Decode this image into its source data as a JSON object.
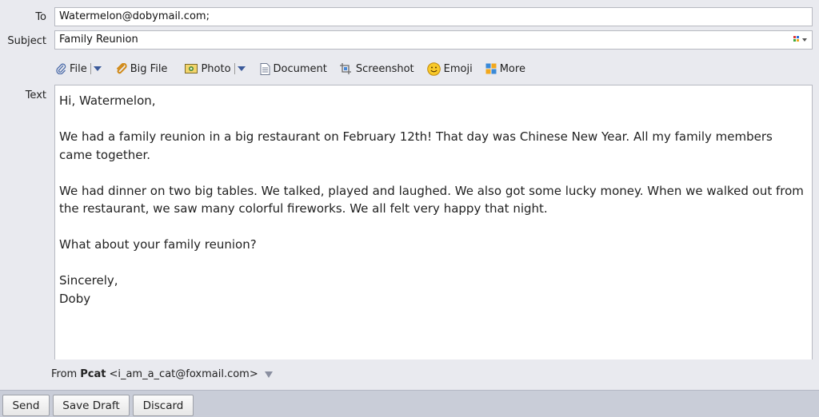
{
  "header": {
    "to_label": "To",
    "to_value": "Watermelon@dobymail.com;",
    "subject_label": "Subject",
    "subject_value": "Family Reunion"
  },
  "toolbar": {
    "items": [
      {
        "label": "File",
        "icon": "paperclip-icon",
        "has_dropdown": true
      },
      {
        "label": "Big File",
        "icon": "big-file-icon",
        "has_dropdown": false
      },
      {
        "label": "Photo",
        "icon": "photo-icon",
        "has_dropdown": true
      },
      {
        "label": "Document",
        "icon": "document-icon",
        "has_dropdown": false
      },
      {
        "label": "Screenshot",
        "icon": "scissors-icon",
        "has_dropdown": false
      },
      {
        "label": "Emoji",
        "icon": "smiley-icon",
        "has_dropdown": false
      },
      {
        "label": "More",
        "icon": "grid-icon",
        "has_dropdown": false
      }
    ]
  },
  "body": {
    "label": "Text",
    "greeting": "Hi, Watermelon,",
    "paragraph1": "We had a family reunion in a big restaurant on February 12th! That day was Chinese New Year. All my family members came together.",
    "paragraph2": "We had dinner on two big tables. We talked, played and laughed. We also got some lucky money. When we walked out from the restaurant, we saw many colorful fireworks. We all felt very happy that night.",
    "paragraph3": "What about your family reunion?",
    "closing": "Sincerely,",
    "signature": "Doby"
  },
  "from": {
    "label": "From",
    "name": "Pcat",
    "email": "<i_am_a_cat@foxmail.com>"
  },
  "footer": {
    "send_label": "Send",
    "save_draft_label": "Save Draft",
    "discard_label": "Discard"
  },
  "colors": {
    "background": "#e9eaef",
    "footer_bar": "#c9cdd8",
    "accent_blue": "#3b5a9a"
  }
}
